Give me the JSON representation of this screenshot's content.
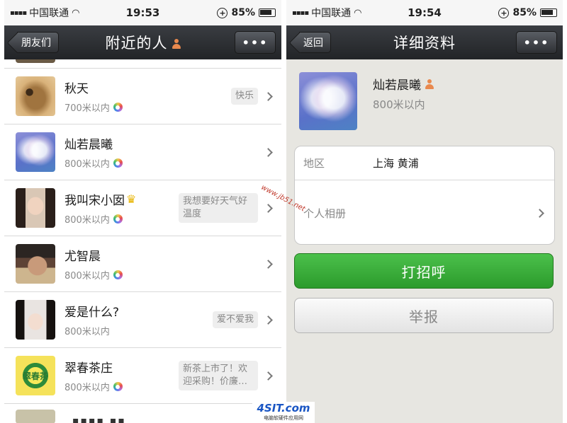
{
  "left": {
    "status": {
      "carrier": "中国联通",
      "time": "19:53",
      "battery": "85%"
    },
    "nav": {
      "back": "朋友们",
      "title": "附近的人",
      "more": "•••"
    },
    "rows": [
      {
        "name": "秋天",
        "dist": "700米以内",
        "sig": "快乐"
      },
      {
        "name": "灿若晨曦",
        "dist": "800米以内",
        "sig": ""
      },
      {
        "name": "我叫宋小囡",
        "dist": "800米以内",
        "sig": "我想要好天气好温度"
      },
      {
        "name": "尤智晨",
        "dist": "800米以内",
        "sig": ""
      },
      {
        "name": "爱是什么?",
        "dist": "800米以内",
        "sig": "爱不爱我"
      },
      {
        "name": "翠春茶庄",
        "dist": "800米以内",
        "sig": "新茶上市了！欢迎采购！价廉…"
      }
    ],
    "partial_name": "▪▪▪▪ ▪▪",
    "avatar6_text": "翠春茶"
  },
  "right": {
    "status": {
      "carrier": "中国联通",
      "time": "19:54",
      "battery": "85%"
    },
    "nav": {
      "back": "返回",
      "title": "详细资料",
      "more": "•••"
    },
    "profile": {
      "name": "灿若晨曦",
      "dist": "800米以内"
    },
    "region_label": "地区",
    "region_value": "上海 黄浦",
    "album_label": "个人相册",
    "greet_button": "打招呼",
    "report_button": "举报"
  },
  "watermark": "www.jb51.net",
  "logo": {
    "main": "4SIT.com",
    "sub": "电脑软硬件应用网"
  }
}
